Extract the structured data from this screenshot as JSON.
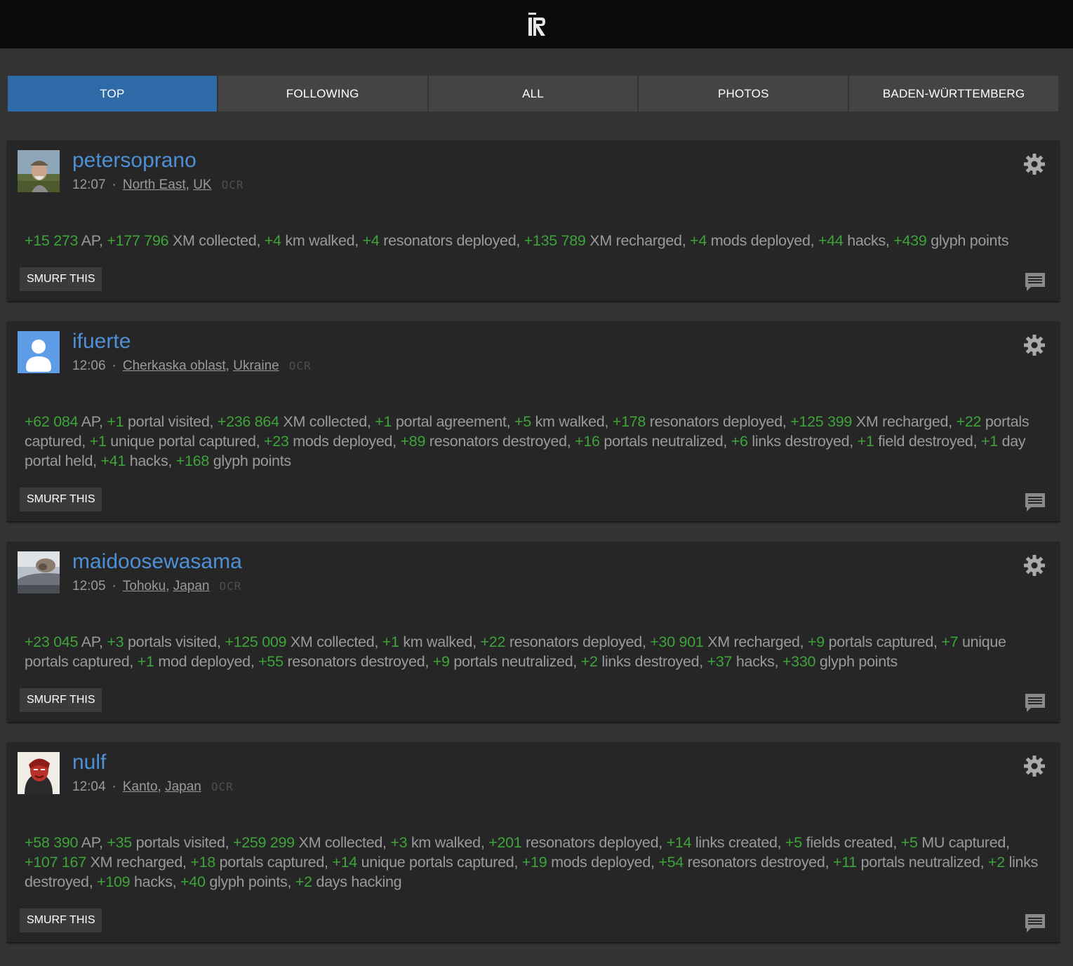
{
  "header": {
    "logo_icon": "ingress-logo-icon"
  },
  "tabs": [
    {
      "label": "TOP",
      "active": true
    },
    {
      "label": "FOLLOWING",
      "active": false
    },
    {
      "label": "ALL",
      "active": false
    },
    {
      "label": "PHOTOS",
      "active": false
    },
    {
      "label": "BADEN-WÜRTTEMBERG",
      "active": false
    }
  ],
  "colors": {
    "accent_tab": "#2f6aa8",
    "username": "#4d90d6",
    "stat_value": "#3ea33a",
    "card_bg": "#262626",
    "page_bg": "#333333"
  },
  "posts": [
    {
      "username": "petersoprano",
      "time": "12:07",
      "region": "North East",
      "country": "UK",
      "ocr": "OCR",
      "smurf": "SMURF THIS",
      "stats": [
        {
          "v": "+15 273",
          "t": "AP"
        },
        {
          "v": "+177 796",
          "t": "XM collected"
        },
        {
          "v": "+4",
          "t": "km walked"
        },
        {
          "v": "+4",
          "t": "resonators deployed"
        },
        {
          "v": "+135 789",
          "t": "XM recharged"
        },
        {
          "v": "+4",
          "t": "mods deployed"
        },
        {
          "v": "+44",
          "t": "hacks"
        },
        {
          "v": "+439",
          "t": "glyph points"
        }
      ]
    },
    {
      "username": "ifuerte",
      "time": "12:06",
      "region": "Cherkaska oblast",
      "country": "Ukraine",
      "ocr": "OCR",
      "smurf": "SMURF THIS",
      "stats": [
        {
          "v": "+62 084",
          "t": "AP"
        },
        {
          "v": "+1",
          "t": "portal visited"
        },
        {
          "v": "+236 864",
          "t": "XM collected"
        },
        {
          "v": "+1",
          "t": "portal agreement"
        },
        {
          "v": "+5",
          "t": "km walked"
        },
        {
          "v": "+178",
          "t": "resonators deployed"
        },
        {
          "v": "+125 399",
          "t": "XM recharged"
        },
        {
          "v": "+22",
          "t": "portals captured"
        },
        {
          "v": "+1",
          "t": "unique portal captured"
        },
        {
          "v": "+23",
          "t": "mods deployed"
        },
        {
          "v": "+89",
          "t": "resonators destroyed"
        },
        {
          "v": "+16",
          "t": "portals neutralized"
        },
        {
          "v": "+6",
          "t": "links destroyed"
        },
        {
          "v": "+1",
          "t": "field destroyed"
        },
        {
          "v": "+1",
          "t": "day portal held"
        },
        {
          "v": "+41",
          "t": "hacks"
        },
        {
          "v": "+168",
          "t": "glyph points"
        }
      ]
    },
    {
      "username": "maidoosewasama",
      "time": "12:05",
      "region": "Tohoku",
      "country": "Japan",
      "ocr": "OCR",
      "smurf": "SMURF THIS",
      "stats": [
        {
          "v": "+23 045",
          "t": "AP"
        },
        {
          "v": "+3",
          "t": "portals visited"
        },
        {
          "v": "+125 009",
          "t": "XM collected"
        },
        {
          "v": "+1",
          "t": "km walked"
        },
        {
          "v": "+22",
          "t": "resonators deployed"
        },
        {
          "v": "+30 901",
          "t": "XM recharged"
        },
        {
          "v": "+9",
          "t": "portals captured"
        },
        {
          "v": "+7",
          "t": "unique portals captured"
        },
        {
          "v": "+1",
          "t": "mod deployed"
        },
        {
          "v": "+55",
          "t": "resonators destroyed"
        },
        {
          "v": "+9",
          "t": "portals neutralized"
        },
        {
          "v": "+2",
          "t": "links destroyed"
        },
        {
          "v": "+37",
          "t": "hacks"
        },
        {
          "v": "+330",
          "t": "glyph points"
        }
      ]
    },
    {
      "username": "nulf",
      "time": "12:04",
      "region": "Kanto",
      "country": "Japan",
      "ocr": "OCR",
      "smurf": "SMURF THIS",
      "stats": [
        {
          "v": "+58 390",
          "t": "AP"
        },
        {
          "v": "+35",
          "t": "portals visited"
        },
        {
          "v": "+259 299",
          "t": "XM collected"
        },
        {
          "v": "+3",
          "t": "km walked"
        },
        {
          "v": "+201",
          "t": "resonators deployed"
        },
        {
          "v": "+14",
          "t": "links created"
        },
        {
          "v": "+5",
          "t": "fields created"
        },
        {
          "v": "+5",
          "t": "MU captured"
        },
        {
          "v": "+107 167",
          "t": "XM recharged"
        },
        {
          "v": "+18",
          "t": "portals captured"
        },
        {
          "v": "+14",
          "t": "unique portals captured"
        },
        {
          "v": "+19",
          "t": "mods deployed"
        },
        {
          "v": "+54",
          "t": "resonators destroyed"
        },
        {
          "v": "+11",
          "t": "portals neutralized"
        },
        {
          "v": "+2",
          "t": "links destroyed"
        },
        {
          "v": "+109",
          "t": "hacks"
        },
        {
          "v": "+40",
          "t": "glyph points"
        },
        {
          "v": "+2",
          "t": "days hacking"
        }
      ]
    }
  ]
}
